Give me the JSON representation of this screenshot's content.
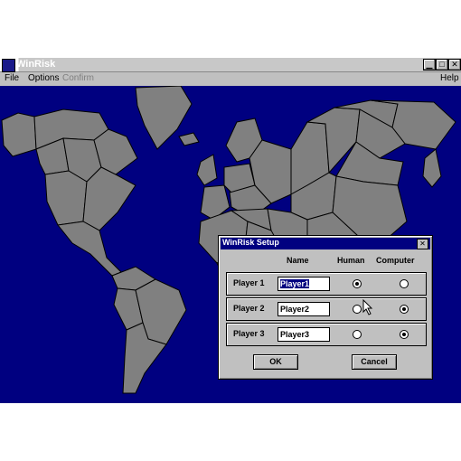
{
  "window": {
    "title": "WinRisk"
  },
  "menu": {
    "file": "File",
    "options": "Options",
    "confirm": "Confirm",
    "help": "Help"
  },
  "window_controls": {
    "minimize": "▁",
    "maximize": "□",
    "close": "✕"
  },
  "dialog": {
    "title": "WinRisk Setup",
    "close": "✕",
    "headers": {
      "name": "Name",
      "human": "Human",
      "computer": "Computer"
    },
    "players": [
      {
        "label": "Player 1",
        "name": "Player1",
        "type": "Human"
      },
      {
        "label": "Player 2",
        "name": "Player2",
        "type": "Computer"
      },
      {
        "label": "Player 3",
        "name": "Player3",
        "type": "Computer"
      }
    ],
    "ok_label": "OK",
    "cancel_label": "Cancel"
  },
  "colors": {
    "ocean": "#000080",
    "land": "#808080",
    "border": "#000000"
  }
}
